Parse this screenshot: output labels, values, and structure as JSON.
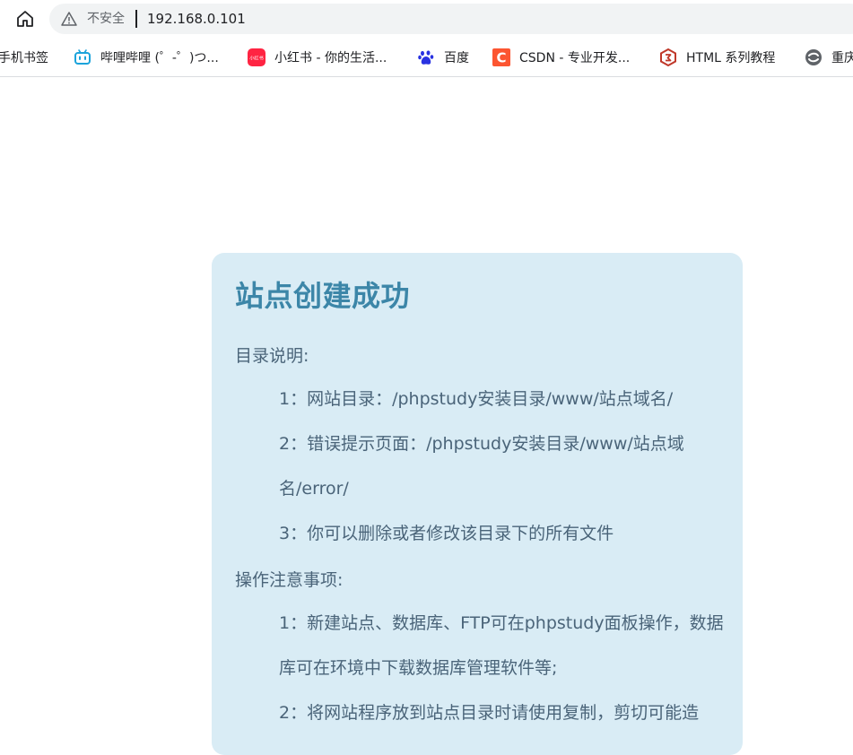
{
  "browser": {
    "security_label": "不安全",
    "url": "192.168.0.101",
    "bookmarks": [
      {
        "label": "手机书签"
      },
      {
        "label": "哔哩哔哩 (゜-゜)つ..."
      },
      {
        "label": "小红书 - 你的生活..."
      },
      {
        "label": "百度"
      },
      {
        "label": "CSDN - 专业开发..."
      },
      {
        "label": "HTML 系列教程"
      },
      {
        "label": "重庆"
      }
    ],
    "favicons": {
      "bilibili": "#1ba3db",
      "xiaohongshu": "#ff2442",
      "xiaohongshu_text": "小红书",
      "baidu": "#2932e1",
      "csdn": "#fc5531",
      "csdn_letter": "C",
      "html": "#c0392b",
      "chongqing": "#5f6368"
    }
  },
  "content": {
    "title": "站点创建成功",
    "dir_heading": "目录说明:",
    "dir_items": [
      "1：网站目录：/phpstudy安装目录/www/站点域名/",
      "2：错误提示页面：/phpstudy安装目录/www/站点域名/error/",
      "3：你可以删除或者修改该目录下的所有文件"
    ],
    "ops_heading": "操作注意事项:",
    "ops_items": [
      "1：新建站点、数据库、FTP可在phpstudy面板操作，数据库可在环境中下载数据库管理软件等;",
      "2：将网站程序放到站点目录时请使用复制，剪切可能造"
    ]
  },
  "colors": {
    "card_bg": "#d9ecf5",
    "title": "#3c86a8",
    "text": "#4a6479"
  }
}
